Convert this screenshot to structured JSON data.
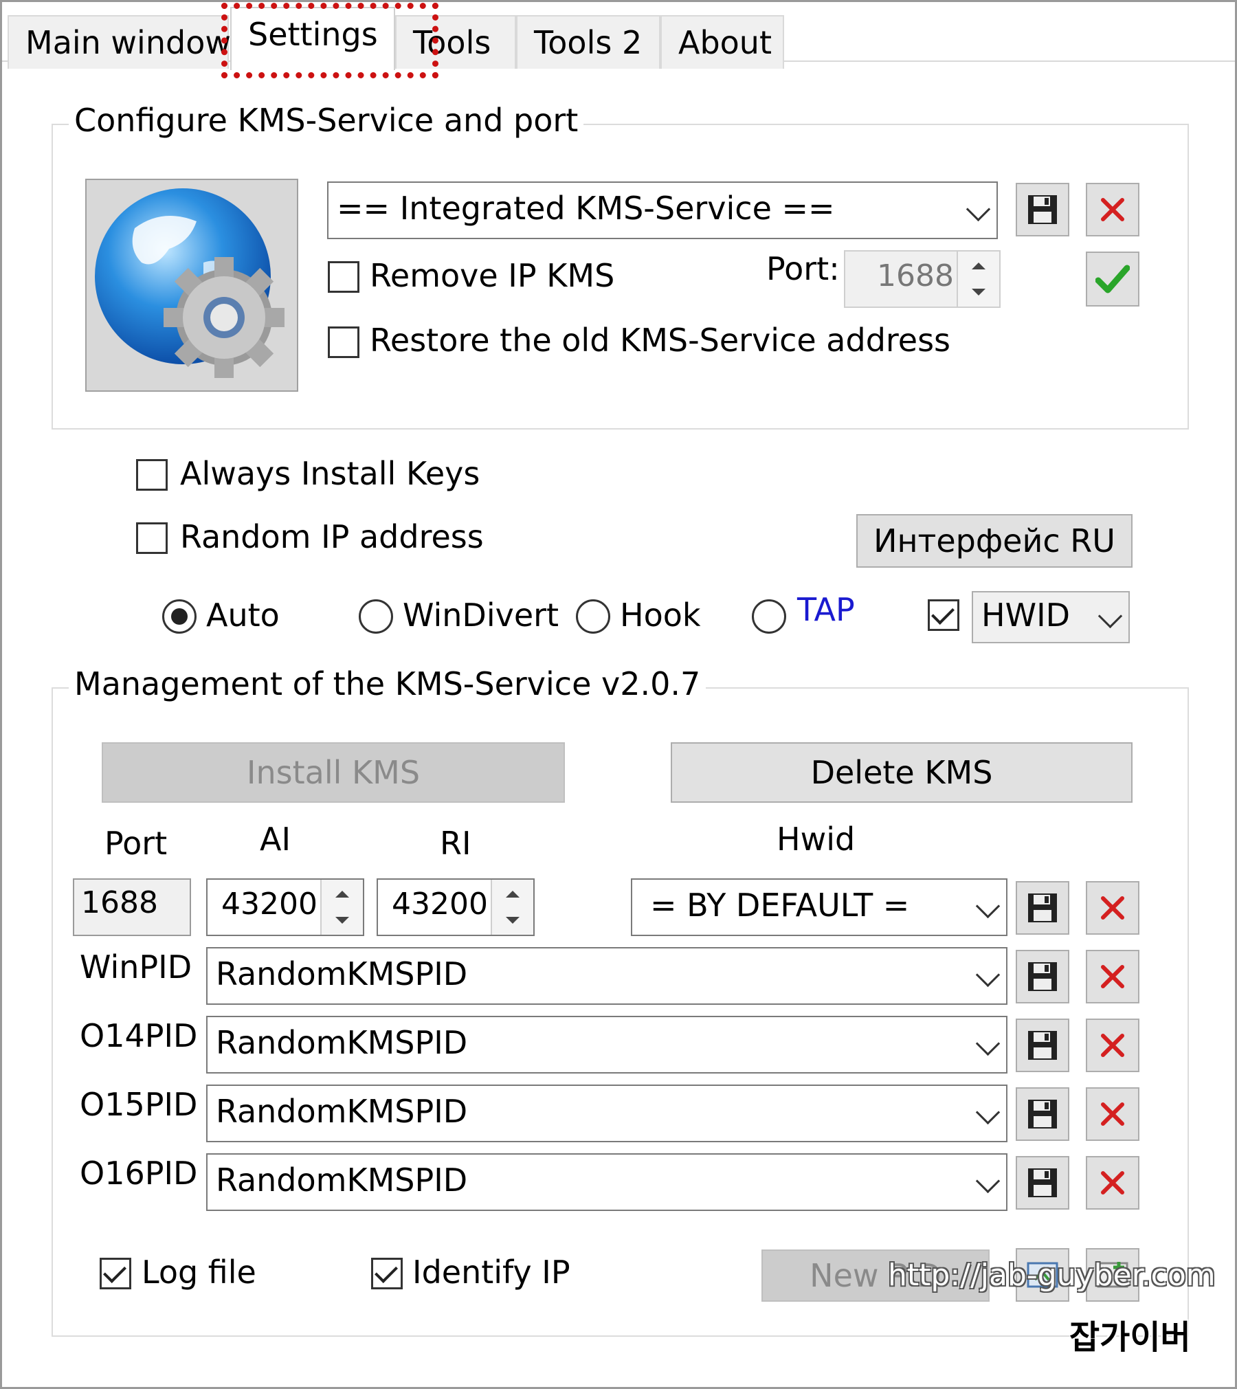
{
  "tabs": [
    {
      "label": "Main window",
      "active": false
    },
    {
      "label": "Settings",
      "active": true
    },
    {
      "label": "Tools",
      "active": false
    },
    {
      "label": "Tools 2",
      "active": false
    },
    {
      "label": "About",
      "active": false
    }
  ],
  "kms_group": {
    "title": "Configure KMS-Service and port",
    "service_combo": "== Integrated KMS-Service ==",
    "remove_ip_label": "Remove IP KMS",
    "port_label": "Port:",
    "port_value": "1688",
    "restore_label": "Restore the old KMS-Service address"
  },
  "options": {
    "always_install_keys": "Always Install Keys",
    "random_ip": "Random IP address",
    "interface_ru_button": "Интерфейс RU",
    "modes": [
      "Auto",
      "WinDivert",
      "Hook",
      "TAP"
    ],
    "selected_mode": "Auto",
    "hwid_checked": true,
    "hwid_combo": "HWID"
  },
  "management": {
    "title": "Management of the KMS-Service v2.0.7",
    "install_button": "Install KMS",
    "delete_button": "Delete KMS",
    "col_port": "Port",
    "col_ai": "AI",
    "col_ri": "RI",
    "col_hwid": "Hwid",
    "port_value": "1688",
    "ai_value": "43200",
    "ri_value": "43200",
    "hwid_value": "= BY DEFAULT =",
    "pid_rows": [
      {
        "label": "WinPID",
        "value": "RandomKMSPID"
      },
      {
        "label": "O14PID",
        "value": "RandomKMSPID"
      },
      {
        "label": "O15PID",
        "value": "RandomKMSPID"
      },
      {
        "label": "O16PID",
        "value": "RandomKMSPID"
      }
    ],
    "log_file_label": "Log file",
    "identify_ip_label": "Identify IP",
    "new_pid_button": "New PID"
  },
  "watermark": {
    "url": "http://jab-guyber.com",
    "korean": "잡가이버"
  },
  "colors": {
    "highlight": "#cc1111",
    "tap_label": "#1a1ad0",
    "delete_x": "#d42020",
    "ok_check": "#2aa52a"
  }
}
